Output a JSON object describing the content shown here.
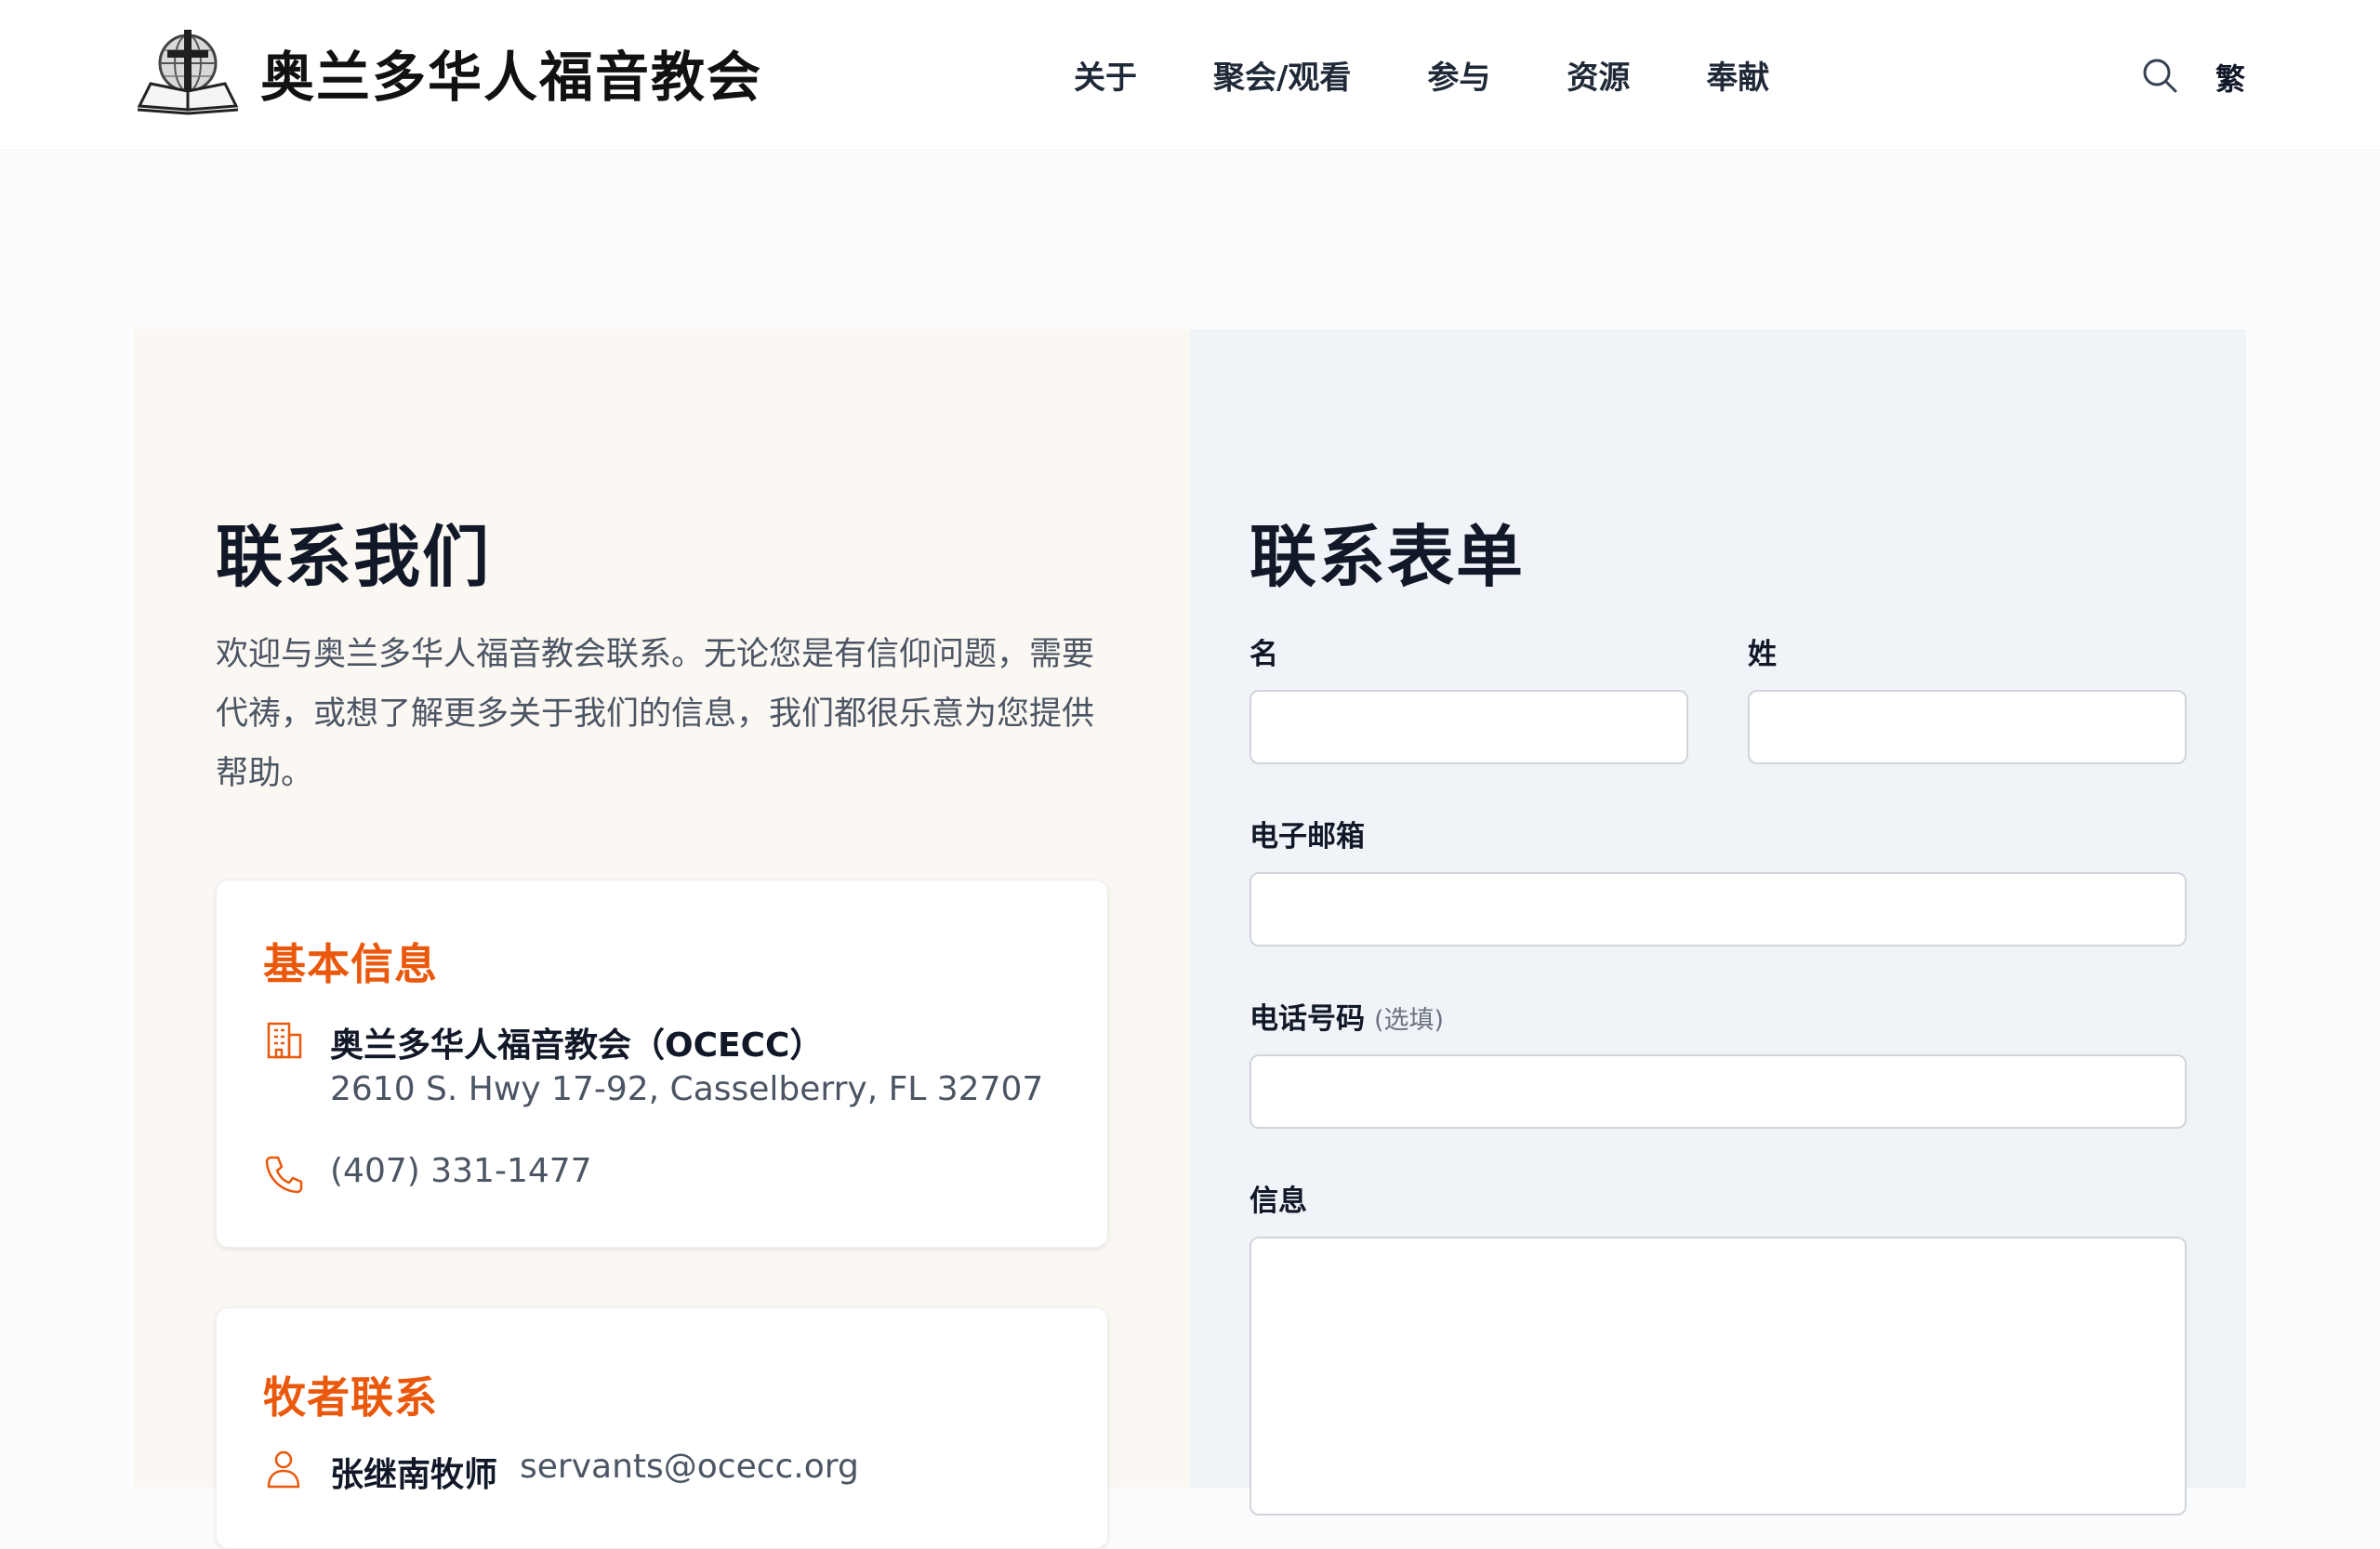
{
  "header": {
    "site_title": "奥兰多华人福音教会",
    "nav": [
      "关于",
      "聚会/观看",
      "参与",
      "资源",
      "奉献"
    ],
    "search_icon": "search-icon",
    "lang_toggle": "繁"
  },
  "contact": {
    "title": "联系我们",
    "intro": "欢迎与奥兰多华人福音教会联系。无论您是有信仰问题，需要代祷，或想了解更多关于我们的信息，我们都很乐意为您提供帮助。",
    "basic_info": {
      "title": "基本信息",
      "org_name": "奥兰多华人福音教会（OCECC）",
      "address": "2610 S. Hwy 17-92, Casselberry, FL 32707",
      "phone": "(407) 331-1477",
      "icons": [
        "building-icon",
        "phone-icon"
      ]
    },
    "pastor": {
      "title": "牧者联系",
      "name": "张继南牧师",
      "email": "servants@ocecc.org",
      "icon": "person-icon"
    }
  },
  "form": {
    "title": "联系表单",
    "first_name_label": "名",
    "last_name_label": "姓",
    "email_label": "电子邮箱",
    "phone_label": "电话号码",
    "phone_optional": "(选填)",
    "message_label": "信息"
  },
  "colors": {
    "accent": "#ea580c",
    "left_bg": "#fbf7f3",
    "right_bg": "#f0f4f8"
  }
}
